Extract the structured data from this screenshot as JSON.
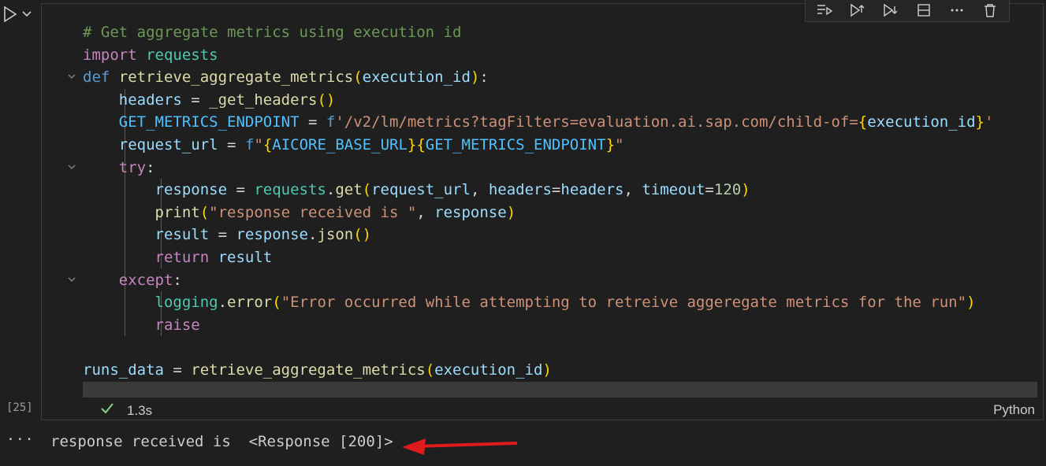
{
  "cell": {
    "execution_count": "[25]",
    "duration": "1.3s",
    "language": "Python"
  },
  "code": {
    "l1": "# Get aggregate metrics using execution id",
    "l2_kw": "import",
    "l2_mod": "requests",
    "l3_def": "def",
    "l3_fn": "retrieve_aggregate_metrics",
    "l3_param": "execution_id",
    "l4_var": "headers",
    "l4_fn": "_get_headers",
    "l5_const": "GET_METRICS_ENDPOINT",
    "l5_prefix": "f",
    "l5_str": "'/v2/lm/metrics?tagFilters=evaluation.ai.sap.com/child-of=",
    "l5_interp": "execution_id",
    "l5_end": "'",
    "l6_var": "request_url",
    "l6_prefix": "f",
    "l6_q": "\"",
    "l6_a": "AICORE_BASE_URL",
    "l6_b": "GET_METRICS_ENDPOINT",
    "l7": "try",
    "l8_var": "response",
    "l8_mod": "requests",
    "l8_fn": "get",
    "l8_a": "request_url",
    "l8_k1": "headers",
    "l8_v1": "headers",
    "l8_k2": "timeout",
    "l8_v2": "120",
    "l9_fn": "print",
    "l9_str": "\"response received is \"",
    "l9_arg": "response",
    "l10_var": "result",
    "l10_obj": "response",
    "l10_fn": "json",
    "l11_kw": "return",
    "l11_var": "result",
    "l12": "except",
    "l13_mod": "logging",
    "l13_fn": "error",
    "l13_str": "\"Error occurred while attempting to retreive aggeregate metrics for the run\"",
    "l14": "raise",
    "l15_var": "runs_data",
    "l15_fn": "retrieve_aggregate_metrics",
    "l15_arg": "execution_id"
  },
  "output": {
    "text": "response received is  <Response [200]>",
    "more": "···"
  },
  "colors": {
    "annotation_arrow": "#e01b1b",
    "success_check": "#89d185"
  }
}
